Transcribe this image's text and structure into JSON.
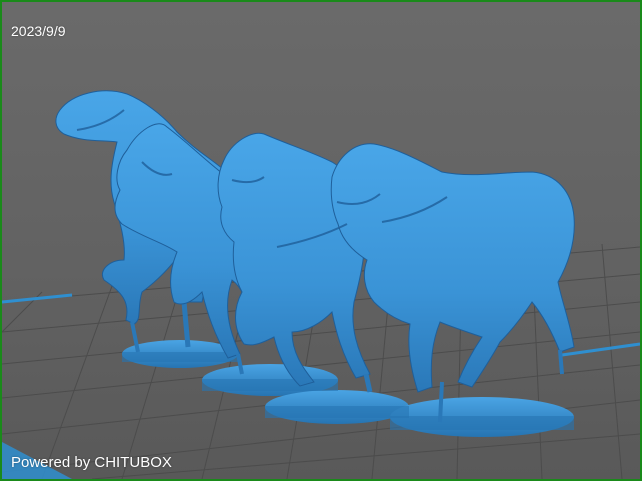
{
  "viewport": {
    "date_stamp": "2023/9/9",
    "watermark": "Powered by CHITUBOX",
    "background_color": "#626262",
    "build_plate_grid_color": "#4a4a4a",
    "build_plate_edge_color": "#2f8fd0",
    "model_color": "#3a93d6",
    "model_shadow_color": "#1f5f9a",
    "model_description_icon": "horse-miniatures-icon"
  }
}
